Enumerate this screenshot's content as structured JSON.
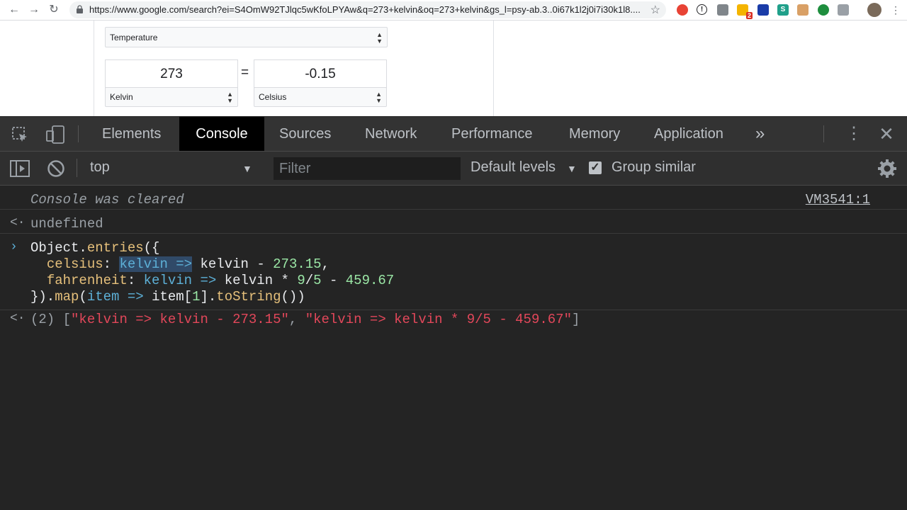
{
  "browser": {
    "url": "https://www.google.com/search?ei=S4OmW92TJlqc5wKfoLPYAw&q=273+kelvin&oq=273+kelvin&gs_l=psy-ab.3..0i67k1l2j0i7i30k1l8....",
    "extension_badge": "2"
  },
  "converter": {
    "unit_type": "Temperature",
    "from_value": "273",
    "from_unit": "Kelvin",
    "equals": "=",
    "to_value": "-0.15",
    "to_unit": "Celsius"
  },
  "devtools": {
    "tabs": [
      "Elements",
      "Console",
      "Sources",
      "Network",
      "Performance",
      "Memory",
      "Application"
    ],
    "more_tabs": "»",
    "context": "top",
    "filter_placeholder": "Filter",
    "levels": "Default levels",
    "group_similar": "Group similar",
    "console": {
      "cleared": "Console was cleared",
      "cleared_source": "VM3541:1",
      "undefined": "undefined",
      "input_lines": {
        "l1_a": "Object",
        "l1_b": ".",
        "l1_c": "entries",
        "l1_d": "({",
        "l2_prop": "celsius",
        "l2_colon": ": ",
        "l2_param": "kelvin",
        "l2_arrow": " =>",
        "l2_sp": " ",
        "l2_body": "kelvin",
        "l2_minus": " - ",
        "l2_num": "273.15",
        "l2_comma": ",",
        "l3_prop": "fahrenheit",
        "l3_colon": ": ",
        "l3_param": "kelvin",
        "l3_arrow": " => ",
        "l3_body": "kelvin",
        "l3_mul": " * ",
        "l3_num1": "9",
        "l3_div": "/",
        "l3_num2": "5",
        "l3_minus": " - ",
        "l3_num3": "459.67",
        "l4_a": "}).",
        "l4_map": "map",
        "l4_b": "(",
        "l4_item": "item",
        "l4_arrow": " => ",
        "l4_c": "item[",
        "l4_one": "1",
        "l4_d": "].",
        "l4_tostring": "toString",
        "l4_e": "())"
      },
      "result": {
        "count": "(2)",
        "open": " [",
        "item1": "\"kelvin => kelvin - 273.15\"",
        "sep": ", ",
        "item2": "\"kelvin => kelvin * 9/5 - 459.67\"",
        "close": "]"
      }
    }
  }
}
